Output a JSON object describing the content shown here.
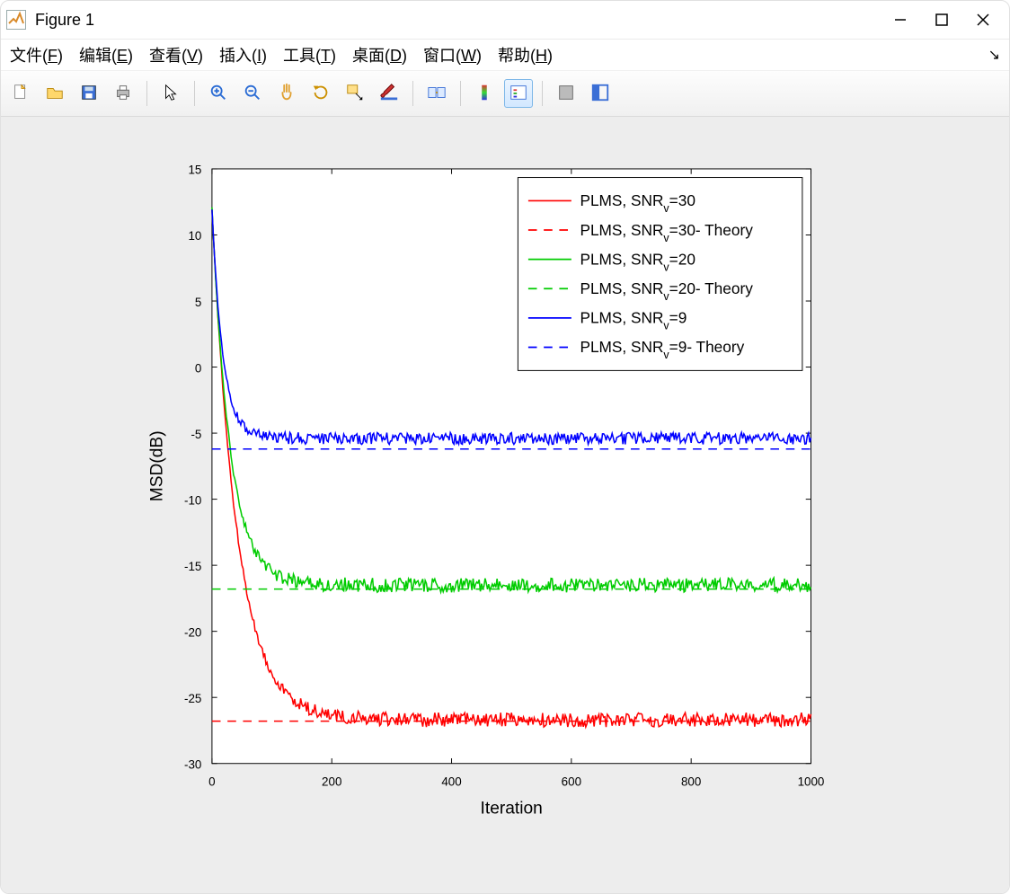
{
  "window": {
    "title": "Figure 1"
  },
  "menu": {
    "file": {
      "label": "文件",
      "accel": "F"
    },
    "edit": {
      "label": "编辑",
      "accel": "E"
    },
    "view": {
      "label": "查看",
      "accel": "V"
    },
    "insert": {
      "label": "插入",
      "accel": "I"
    },
    "tools": {
      "label": "工具",
      "accel": "T"
    },
    "desktop": {
      "label": "桌面",
      "accel": "D"
    },
    "window": {
      "label": "窗口",
      "accel": "W"
    },
    "help": {
      "label": "帮助",
      "accel": "H"
    }
  },
  "toolbar": {
    "items": [
      {
        "id": "new"
      },
      {
        "id": "open"
      },
      {
        "id": "save"
      },
      {
        "id": "print"
      },
      {
        "id": "sep"
      },
      {
        "id": "pointer"
      },
      {
        "id": "sep"
      },
      {
        "id": "zoom-in"
      },
      {
        "id": "zoom-out"
      },
      {
        "id": "pan"
      },
      {
        "id": "rotate"
      },
      {
        "id": "data-cursor"
      },
      {
        "id": "brush"
      },
      {
        "id": "sep"
      },
      {
        "id": "link"
      },
      {
        "id": "sep"
      },
      {
        "id": "colorbar"
      },
      {
        "id": "legend",
        "toggled": true
      },
      {
        "id": "sep"
      },
      {
        "id": "hide-tools"
      },
      {
        "id": "dock-fig"
      }
    ]
  },
  "chart_data": {
    "type": "line",
    "xlabel": "Iteration",
    "ylabel": "MSD(dB)",
    "xlim": [
      0,
      1000
    ],
    "ylim": [
      -30,
      15
    ],
    "xticks": [
      0,
      200,
      400,
      600,
      800,
      1000
    ],
    "yticks": [
      -30,
      -25,
      -20,
      -15,
      -10,
      -5,
      0,
      5,
      10,
      15
    ],
    "legend_position": "upper-right",
    "series": [
      {
        "name": "PLMS, SNR_v=30",
        "color": "#ff0000",
        "dash": "solid",
        "kind": "decay_noise",
        "y0": 12,
        "floor": -26.7,
        "tau": 42,
        "noise": 0.55
      },
      {
        "name": "PLMS, SNR_v=30- Theory",
        "color": "#ff0000",
        "dash": "dash",
        "kind": "hline",
        "value": -26.8
      },
      {
        "name": "PLMS, SNR_v=20",
        "color": "#00cc00",
        "dash": "solid",
        "kind": "decay_noise",
        "y0": 12,
        "floor": -16.5,
        "tau": 30,
        "noise": 0.55
      },
      {
        "name": "PLMS, SNR_v=20- Theory",
        "color": "#00cc00",
        "dash": "dash",
        "kind": "hline",
        "value": -16.8
      },
      {
        "name": "PLMS, SNR_v=9",
        "color": "#0000ff",
        "dash": "solid",
        "kind": "decay_noise",
        "y0": 12,
        "floor": -5.4,
        "tau": 18,
        "noise": 0.45
      },
      {
        "name": "PLMS, SNR_v=9- Theory",
        "color": "#0000ff",
        "dash": "dash",
        "kind": "hline",
        "value": -6.2
      }
    ],
    "sample_points": [
      0,
      5,
      10,
      15,
      20,
      30,
      40,
      50,
      60,
      80,
      100,
      120,
      150,
      200,
      300,
      400,
      500,
      600,
      700,
      800,
      900,
      1000
    ],
    "expected_values": {
      "snr30": [
        12,
        6.0,
        1.5,
        -2.0,
        -5.0,
        -9.5,
        -13.0,
        -15.8,
        -18.0,
        -21.0,
        -23.5,
        -25.2,
        -26.2,
        -26.7,
        -26.7,
        -26.7,
        -26.7,
        -26.7,
        -26.7,
        -26.7,
        -26.7,
        -26.7
      ],
      "snr20": [
        12,
        5.5,
        1.0,
        -2.5,
        -5.0,
        -8.8,
        -11.2,
        -13.0,
        -14.0,
        -15.3,
        -16.0,
        -16.3,
        -16.5,
        -16.5,
        -16.5,
        -16.5,
        -16.5,
        -16.5,
        -16.5,
        -16.5,
        -16.5,
        -16.5
      ],
      "snr9": [
        12,
        4.5,
        -0.5,
        -2.5,
        -3.5,
        -4.6,
        -5.0,
        -5.2,
        -5.3,
        -5.4,
        -5.4,
        -5.4,
        -5.4,
        -5.4,
        -5.4,
        -5.4,
        -5.4,
        -5.4,
        -5.4,
        -5.4,
        -5.4,
        -5.4
      ]
    }
  }
}
